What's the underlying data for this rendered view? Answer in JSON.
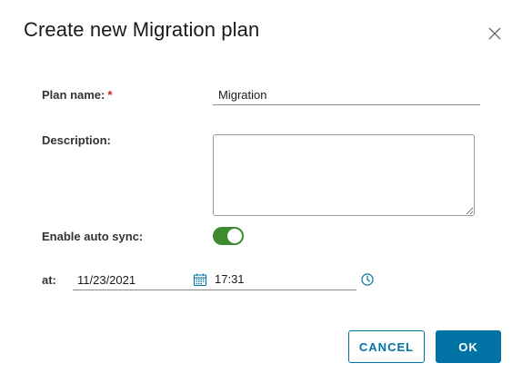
{
  "dialog": {
    "title": "Create new Migration plan",
    "close_icon": "close-icon"
  },
  "form": {
    "plan_name": {
      "label": "Plan name:",
      "required_marker": "*",
      "value": "Migration"
    },
    "description": {
      "label": "Description:",
      "value": ""
    },
    "auto_sync": {
      "label": "Enable auto sync:",
      "enabled": true,
      "on_color": "#3c8b2e"
    },
    "schedule": {
      "label": "at:",
      "date": "11/23/2021",
      "time": "17:31",
      "calendar_icon": "calendar-icon",
      "clock_icon": "clock-icon"
    }
  },
  "actions": {
    "cancel_label": "CANCEL",
    "ok_label": "OK"
  },
  "colors": {
    "primary": "#0072a3",
    "required": "#c92100",
    "toggle_on": "#3c8b2e"
  }
}
